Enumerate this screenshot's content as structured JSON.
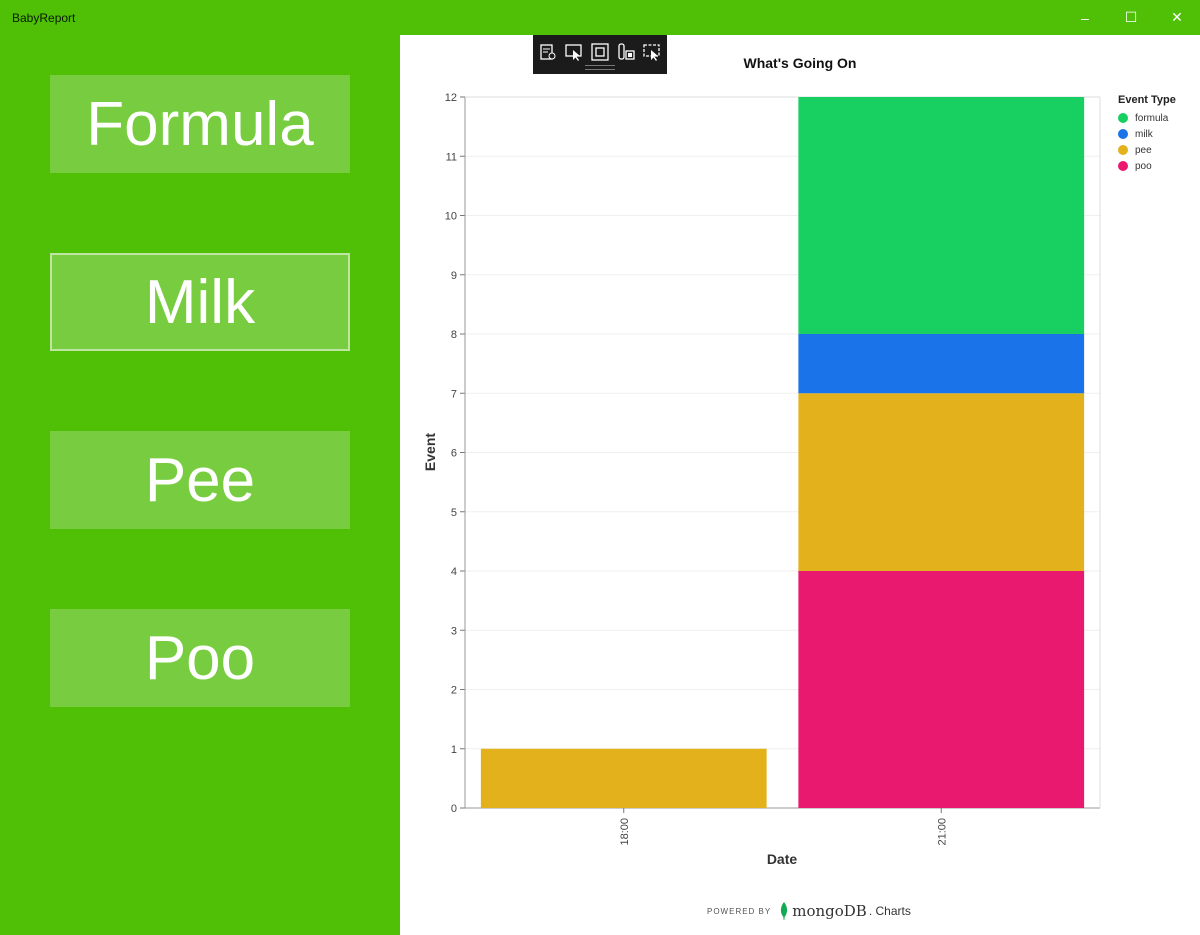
{
  "window": {
    "title": "BabyReport",
    "controls": {
      "minimize": "–",
      "maximize": "☐",
      "close": "✕"
    }
  },
  "buttons": [
    {
      "label": "Formula"
    },
    {
      "label": "Milk"
    },
    {
      "label": "Pee"
    },
    {
      "label": "Poo"
    }
  ],
  "toolbar": {
    "icons": [
      "visual-tree-icon",
      "select-element-icon",
      "display-layout-adorners-icon",
      "track-focus-icon",
      "hot-reload-icon"
    ]
  },
  "footer": {
    "powered_by": "POWERED BY",
    "brand": "mongoDB",
    "brand_suffix": ". Charts"
  },
  "chart_data": {
    "type": "bar",
    "stacked": true,
    "title": "What's Going On",
    "xlabel": "Date",
    "ylabel": "Event",
    "ylim": [
      0,
      12
    ],
    "yticks": [
      "0",
      "1",
      "2",
      "3",
      "4",
      "5",
      "6",
      "7",
      "8",
      "9",
      "10",
      "11",
      "12"
    ],
    "categories": [
      "18:00",
      "21:00"
    ],
    "legend_title": "Event Type",
    "legend_position": "right",
    "series": [
      {
        "name": "poo",
        "color": "#e8196f",
        "values": [
          0,
          4
        ]
      },
      {
        "name": "pee",
        "color": "#e3b11b",
        "values": [
          1,
          3
        ]
      },
      {
        "name": "milk",
        "color": "#1a73e8",
        "values": [
          0,
          1
        ]
      },
      {
        "name": "formula",
        "color": "#18cf62",
        "values": [
          0,
          4
        ]
      }
    ],
    "legend_order": [
      "formula",
      "milk",
      "pee",
      "poo"
    ]
  }
}
